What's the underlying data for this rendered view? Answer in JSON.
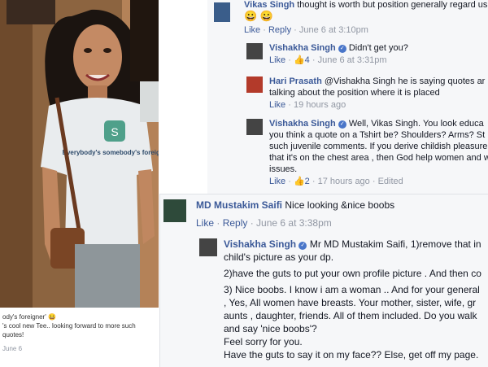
{
  "photo_post": {
    "tshirt_text": "Everybody's somebody's foreigner",
    "caption_line1": "ody's foreigner' 😀",
    "caption_line2": "'s cool new Tee.. looking forward to more such quotes!",
    "caption_date": "June 6"
  },
  "comments": {
    "c1": {
      "author": "Vikas Singh",
      "text": "thought is worth but position generally regard us",
      "emoji": "😀 😀",
      "like": "Like",
      "reply": "Reply",
      "time": "June 6 at 3:10pm"
    },
    "c2": {
      "author": "Vishakha Singh",
      "text": "Didn't get you?",
      "like": "Like",
      "likes_count": "4",
      "time": "June 6 at 3:31pm"
    },
    "c3": {
      "author": "Hari Prasath",
      "lines": [
        "@Vishakha Singh he is saying quotes ar",
        "talking about the position where it is placed"
      ],
      "like": "Like",
      "time": "19 hours ago"
    },
    "c4": {
      "author": "Vishakha Singh",
      "lines": [
        "Well, Vikas Singh. You look educa",
        "you think a quote on a Tshirt be? Shoulders? Arms? St",
        "such juvenile comments. If you derive childish pleasure",
        "that it's on the chest area , then God help women and w",
        "issues."
      ],
      "like": "Like",
      "likes_count": "2",
      "time": "17 hours ago",
      "edited": "Edited"
    },
    "c5": {
      "author": "MD Mustakim Saifi",
      "text": "Nice looking &nice boobs",
      "like": "Like",
      "reply": "Reply",
      "time": "June 6 at 3:38pm"
    },
    "c6": {
      "author": "Vishakha Singh",
      "lines": [
        "Mr MD Mustakim Saifi, 1)remove that in",
        "child's picture as your dp.",
        "2)have the guts to put your own profile picture . And then co",
        "3) Nice boobs. I know i am a woman .. And for your general",
        ", Yes, All women have breasts. Your mother, sister, wife, gr",
        "aunts , daughter, friends. All of them included. Do you walk",
        "and say 'nice boobs'?",
        "Feel sorry for you.",
        "Have the guts to say it on my face?? Else, get off my page."
      ]
    }
  }
}
